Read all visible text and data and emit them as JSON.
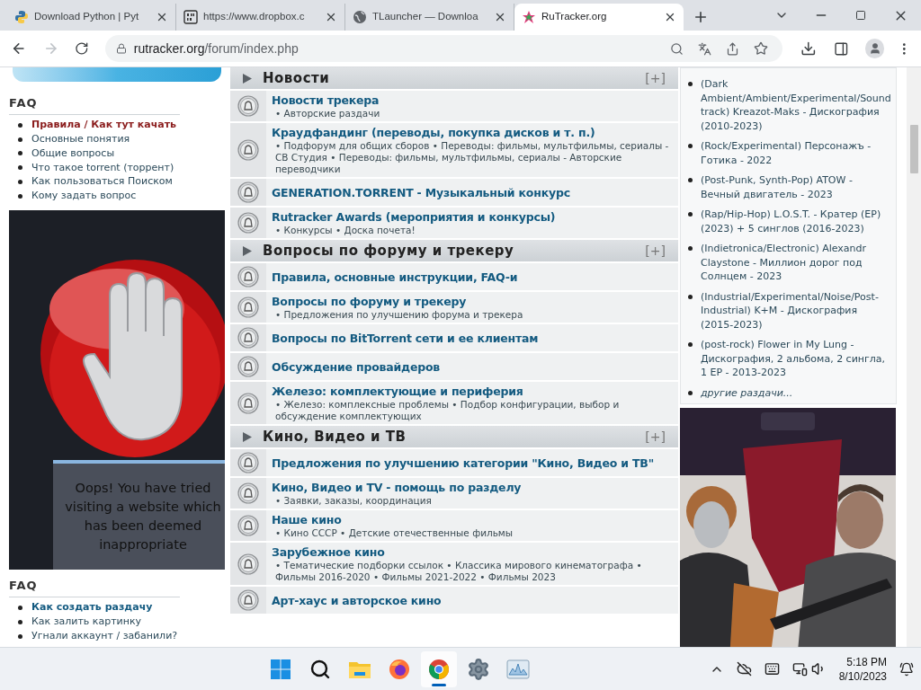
{
  "browser": {
    "tabs": [
      {
        "kind": "python",
        "title": "Download Python | Pyt",
        "selected": false
      },
      {
        "kind": "binary",
        "title": "https://www.dropbox.c",
        "selected": false
      },
      {
        "kind": "globe",
        "title": "TLauncher — Downloa",
        "selected": false
      },
      {
        "kind": "rutracker",
        "title": "RuTracker.org",
        "selected": true
      }
    ],
    "address": {
      "host": "rutracker.org",
      "path": "/forum/index.php"
    }
  },
  "left": {
    "faq_blocks": [
      {
        "title": "FAQ",
        "items": [
          {
            "text": "Правила / Как тут качать",
            "bold": true,
            "color": "#8b1d1d"
          },
          {
            "text": "Основные понятия",
            "bold": false,
            "color": "#2c4a5a"
          },
          {
            "text": "Общие вопросы",
            "bold": false,
            "color": "#2c4a5a"
          },
          {
            "text": "Что такое torrent (торрент)",
            "bold": false,
            "color": "#2c4a5a"
          },
          {
            "text": "Как пользоваться Поиском",
            "bold": false,
            "color": "#2c4a5a"
          },
          {
            "text": "Кому задать вопрос",
            "bold": false,
            "color": "#2c4a5a"
          }
        ]
      },
      {
        "title": "FAQ",
        "items": [
          {
            "text": "Как создать раздачу",
            "bold": true,
            "color": "#135a80"
          },
          {
            "text": "Как залить картинку",
            "bold": false,
            "color": "#2c4a5a"
          },
          {
            "text": "Угнали аккаунт / забанили?",
            "bold": false,
            "color": "#2c4a5a"
          }
        ]
      }
    ],
    "blocked_notice": "Oops! You have tried visiting a website which has been deemed inappropriate"
  },
  "sections": [
    {
      "title": "Новости",
      "toggle": "[+]",
      "forums": [
        {
          "title": "Новости трекера",
          "subforums": "• Авторские раздачи"
        },
        {
          "title": "Краудфандинг (переводы, покупка дисков и т. п.)",
          "subforums": "• Подфорум для общих сборов • Переводы: фильмы, мультфильмы, сериалы - СВ Студия • Переводы: фильмы, мультфильмы, сериалы - Авторские переводчики"
        },
        {
          "title": "GENERATION.TORRENT - Музыкальный конкурс"
        },
        {
          "title": "Rutracker Awards (мероприятия и конкурсы)",
          "subforums": "• Конкурсы • Доска почета!"
        }
      ]
    },
    {
      "title": "Вопросы по форуму и трекеру",
      "toggle": "[+]",
      "forums": [
        {
          "title": "Правила, основные инструкции, FAQ-и"
        },
        {
          "title": "Вопросы по форуму и трекеру",
          "subforums": "• Предложения по улучшению форума и трекера"
        },
        {
          "title": "Вопросы по BitTorrent сети и ее клиентам"
        },
        {
          "title": "Обсуждение провайдеров"
        },
        {
          "title": "Железо: комплектующие и периферия",
          "subforums": "• Железо: комплексные проблемы • Подбор конфигурации, выбор и обсуждение комплектующих"
        }
      ]
    },
    {
      "title": "Кино, Видео и ТВ",
      "toggle": "[+]",
      "forums": [
        {
          "title": "Предложения по улучшению категории \"Кино, Видео и ТВ\""
        },
        {
          "title": "Кино, Видео и TV - помощь по разделу",
          "subforums": "• Заявки, заказы, координация"
        },
        {
          "title": "Наше кино",
          "subforums": "• Кино СССР • Детские отечественные фильмы"
        },
        {
          "title": "Зарубежное кино",
          "subforums": "• Тематические подборки ссылок • Классика мирового кинематографа • Фильмы 2016-2020 • Фильмы 2021-2022 • Фильмы 2023"
        },
        {
          "title": "Арт-хаус и авторское кино"
        }
      ]
    }
  ],
  "releases": [
    {
      "text": "(Dark Ambient/Ambient/Experimental/Soundtrack) Kreazot-Maks - Дискография (2010-2023)",
      "italic": false
    },
    {
      "text": "(Rock/Experimental) Персонажъ - Готика - 2022",
      "italic": false
    },
    {
      "text": "(Post-Punk, Synth-Pop) ATOW - Вечный двигатель - 2023",
      "italic": false
    },
    {
      "text": "(Rap/Hip-Hop) L.O.S.T. - Кратер (EP) (2023) + 5 синглов (2016-2023)",
      "italic": false
    },
    {
      "text": "(Indietronica/Electronic) Alexandr Claystone - Миллион дорог под Солнцем - 2023",
      "italic": false
    },
    {
      "text": "(Industrial/Experimental/Noise/Post-Industrial) K+M - Дискография (2015-2023)",
      "italic": false
    },
    {
      "text": "(post-rock) Flower in My Lung - Дискография, 2 альбома, 2 сингла, 1 EP - 2013-2023",
      "italic": false
    },
    {
      "text": "другие раздачи...",
      "italic": true
    }
  ],
  "taskbar": {
    "apps": [
      {
        "kind": "start",
        "selected": false
      },
      {
        "kind": "search",
        "selected": false
      },
      {
        "kind": "folder",
        "selected": false
      },
      {
        "kind": "firefox",
        "selected": false
      },
      {
        "kind": "chrome",
        "selected": true
      },
      {
        "kind": "settings",
        "selected": false
      },
      {
        "kind": "monitor",
        "selected": false
      }
    ],
    "time": "5:18 PM",
    "date": "8/10/2023"
  }
}
